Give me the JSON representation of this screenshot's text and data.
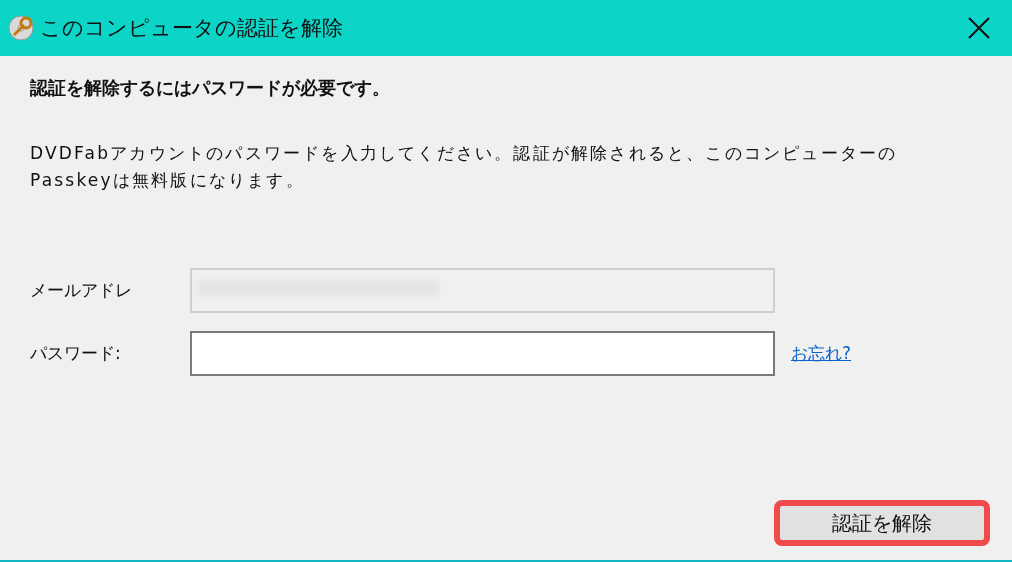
{
  "window": {
    "title": "このコンピュータの認証を解除"
  },
  "heading": "認証を解除するにはパスワードが必要です。",
  "message": "DVDFabアカウントのパスワードを入力してください。認証が解除されると、このコンピューターのPasskeyは無料版になります。",
  "fields": [
    {
      "label": "メールアドレ",
      "disabled": true,
      "redacted": true
    },
    {
      "label": "パスワード:",
      "disabled": false,
      "redacted": false
    }
  ],
  "forgot_link": "お忘れ?",
  "button": {
    "label": "認証を解除",
    "highlighted": true
  }
}
